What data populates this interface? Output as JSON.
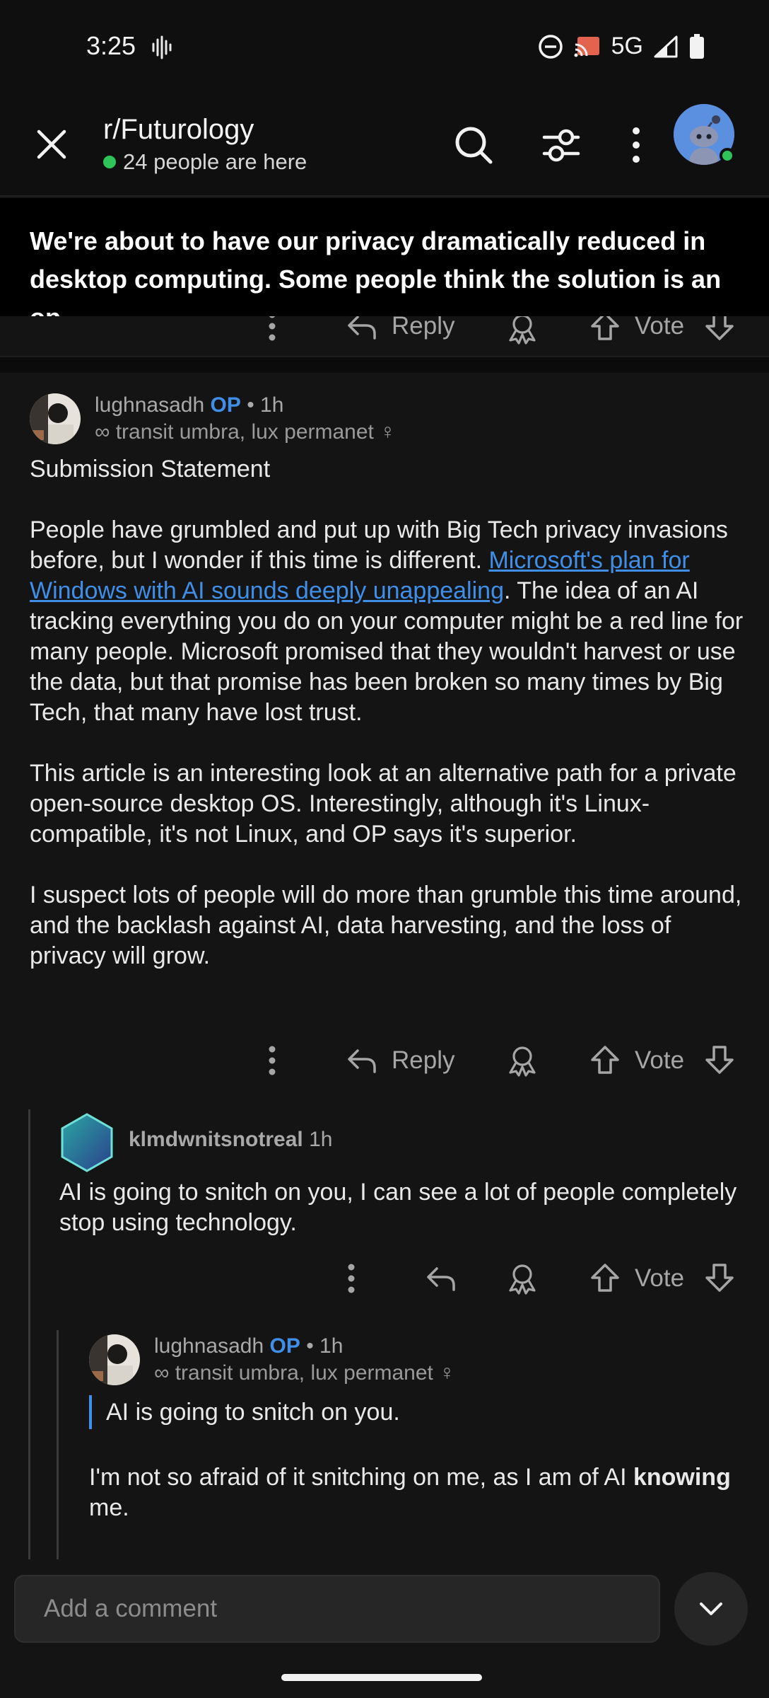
{
  "status_bar": {
    "time": "3:25",
    "network": "5G",
    "icons": [
      "sound-wave-icon",
      "do-not-disturb-icon",
      "cast-icon",
      "signal-icon",
      "battery-icon"
    ]
  },
  "header": {
    "subreddit": "r/Futurology",
    "online_text": "24 people are here",
    "icons": [
      "close-icon",
      "search-icon",
      "filter-icon",
      "more-vertical-icon",
      "avatar"
    ]
  },
  "post": {
    "title": "We're about to have our privacy dramatically reduced in desktop computing. Some people think the solution is an op…"
  },
  "partial_actions": {
    "reply_label": "Reply",
    "vote_label": "Vote"
  },
  "comments": [
    {
      "username": "lughnasadh",
      "op_badge": "OP",
      "age": "• 1h",
      "flair": "∞ transit umbra, lux permanet ♀",
      "heading": "Submission Statement",
      "p1_before_link": "People have grumbled and put up with Big Tech privacy invasions before, but I wonder if this time is different. ",
      "p1_link": "Microsoft's plan for Windows with AI sounds deeply unappealing",
      "p1_after_link": ". The idea of an AI tracking everything you do on your computer might be a red line for many people. Microsoft promised that they wouldn't harvest or use the data, but that promise has been broken so many times by Big Tech, that many have lost trust.",
      "p2": "This article is an interesting look at an alternative path for a private open-source desktop OS. Interestingly, although it's Linux-compatible, it's not Linux, and OP says it's superior.",
      "p3": "I suspect lots of people will do more than grumble this time around, and the backlash against AI, data harvesting, and the loss of privacy will grow.",
      "reply_label": "Reply",
      "vote_label": "Vote"
    },
    {
      "username": "klmdwnitsnotreal",
      "age": "1h",
      "body": "AI is going to snitch on you, I can see a lot of people completely stop using technology.",
      "vote_label": "Vote"
    },
    {
      "username": "lughnasadh",
      "op_badge": "OP",
      "age": "• 1h",
      "flair": "∞ transit umbra, lux permanet ♀",
      "quote": "AI is going to snitch on you.",
      "body_before_bold": "I'm not so afraid of it snitching on me, as I am of AI ",
      "body_bold": "knowing",
      "body_after_bold": " me."
    }
  ],
  "composer": {
    "placeholder": "Add a comment"
  },
  "colors": {
    "background": "#141414",
    "link": "#3f8ee8",
    "online": "#2fc45a",
    "title_bar": "#000000"
  }
}
